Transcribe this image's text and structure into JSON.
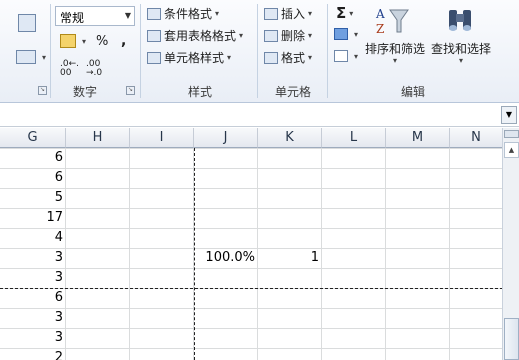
{
  "ribbon": {
    "number_group": {
      "label": "数字",
      "format_value": "常规",
      "percent": "%",
      "comma": ",",
      "increase_decimal": ".0←.00",
      "decrease_decimal": ".00→.0"
    },
    "styles_group": {
      "label": "样式",
      "conditional_format": "条件格式",
      "table_format": "套用表格格式",
      "cell_styles": "单元格样式"
    },
    "cells_group": {
      "label": "单元格",
      "insert": "插入",
      "delete": "删除",
      "format": "格式"
    },
    "editing_group": {
      "label": "编辑",
      "sum_symbol": "Σ",
      "sort_filter": "排序和筛选",
      "find_select": "查找和选择"
    }
  },
  "grid": {
    "columns": [
      "G",
      "H",
      "I",
      "J",
      "K",
      "L",
      "M",
      "N"
    ],
    "g_values": [
      "6",
      "6",
      "5",
      "17",
      "4",
      "3",
      "3",
      "6",
      "3",
      "3",
      "2"
    ],
    "j6": "100.0%",
    "k6": "1"
  }
}
